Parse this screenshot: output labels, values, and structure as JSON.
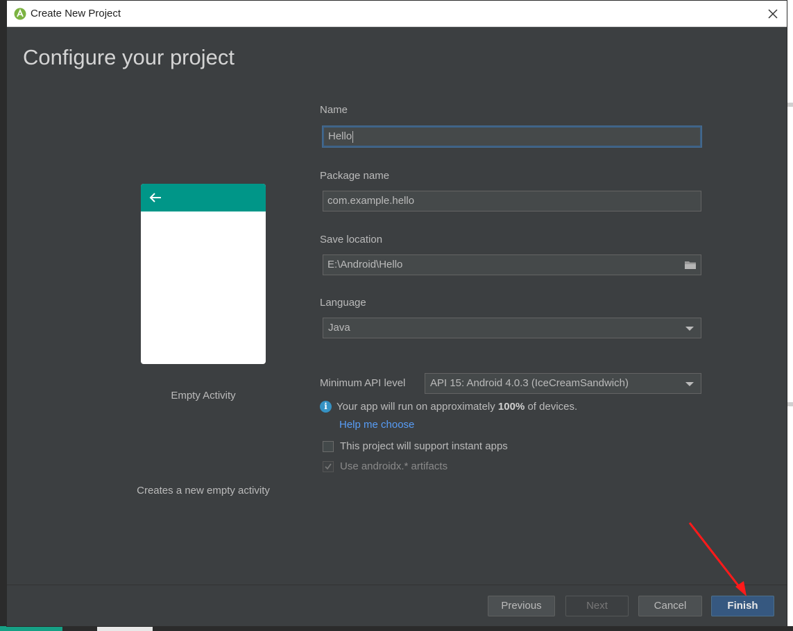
{
  "window": {
    "title": "Create New Project"
  },
  "page": {
    "heading": "Configure your project"
  },
  "template": {
    "name": "Empty Activity",
    "description": "Creates a new empty activity"
  },
  "form": {
    "name": {
      "label": "Name",
      "value": "Hello"
    },
    "package": {
      "label": "Package name",
      "value": "com.example.hello"
    },
    "location": {
      "label": "Save location",
      "value": "E:\\Android\\Hello"
    },
    "language": {
      "label": "Language",
      "value": "Java"
    },
    "min_api": {
      "label": "Minimum API level",
      "value": "API 15: Android 4.0.3 (IceCreamSandwich)"
    }
  },
  "info": {
    "prefix": "Your app will run on approximately ",
    "percent": "100%",
    "suffix": " of devices.",
    "help_link": "Help me choose"
  },
  "options": {
    "instant_apps": {
      "label": "This project will support instant apps",
      "checked": false
    },
    "androidx": {
      "label": "Use androidx.* artifacts",
      "checked": true,
      "disabled": true
    }
  },
  "buttons": {
    "previous": "Previous",
    "next": "Next",
    "cancel": "Cancel",
    "finish": "Finish"
  },
  "colors": {
    "accent": "#365880",
    "template_bar": "#009688",
    "link": "#589df6",
    "annotation_arrow": "#ff1a1a"
  }
}
